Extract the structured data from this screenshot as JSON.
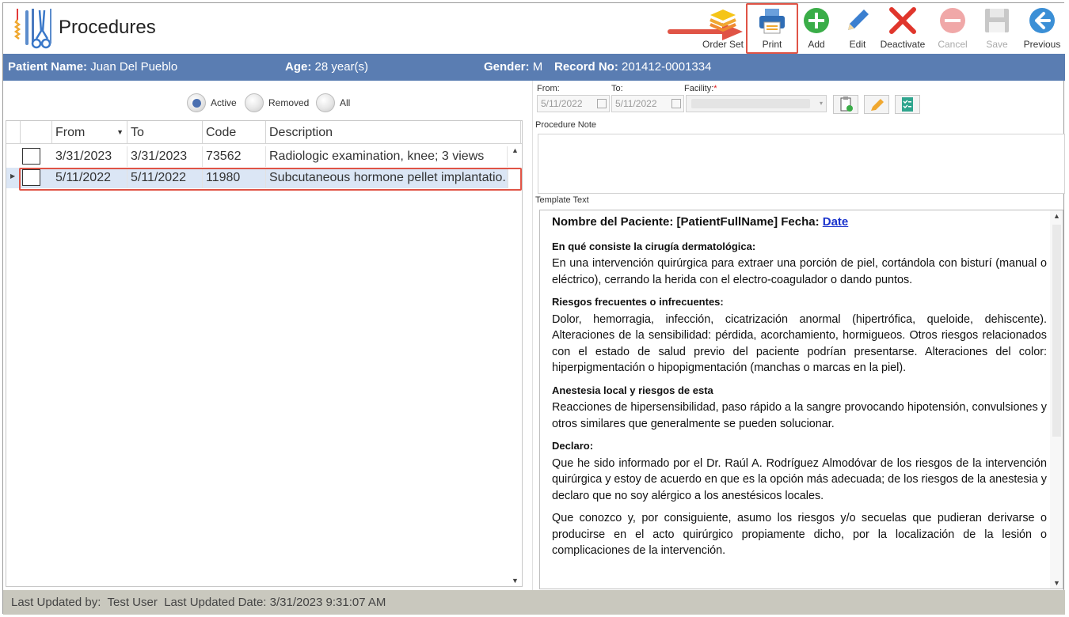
{
  "app": {
    "title": "Procedures"
  },
  "toolbar": {
    "order_set": "Order Set",
    "print": "Print",
    "add": "Add",
    "edit": "Edit",
    "deactivate": "Deactivate",
    "cancel": "Cancel",
    "save": "Save",
    "previous": "Previous"
  },
  "patient": {
    "name_label": "Patient Name:",
    "name": "Juan Del Pueblo",
    "age_label": "Age:",
    "age": "28 year(s)",
    "gender_label": "Gender:",
    "gender": "M",
    "record_label": "Record No:",
    "record": "201412-0001334"
  },
  "filters": {
    "active": "Active",
    "removed": "Removed",
    "all": "All",
    "selected": "Active"
  },
  "grid": {
    "columns": [
      "From",
      "To",
      "Code",
      "Description"
    ],
    "rows": [
      {
        "from": "3/31/2023",
        "to": "3/31/2023",
        "code": "73562",
        "description": "Radiologic examination, knee; 3 views"
      },
      {
        "from": "5/11/2022",
        "to": "5/11/2022",
        "code": "11980",
        "description": "Subcutaneous hormone pellet implantatio..."
      }
    ]
  },
  "detail": {
    "from_label": "From:",
    "from_value": "5/11/2022",
    "to_label": "To:",
    "to_value": "5/11/2022",
    "facility_label": "Facility:",
    "facility_required": "*",
    "procedure_note_label": "Procedure Note",
    "template_text_label": "Template Text"
  },
  "template": {
    "title_prefix": "Nombre del Paciente: [PatientFullName] Fecha: ",
    "title_link": "Date",
    "s1_head": "En qué consiste la cirugía dermatológica:",
    "s1_body": "En una intervención quirúrgica para extraer una porción de piel, cortándola con bisturí (manual o eléctrico), cerrando la herida con el electro-coagulador o dando puntos.",
    "s2_head": "Riesgos frecuentes o infrecuentes:",
    "s2_body": "Dolor, hemorragia, infección, cicatrización anormal (hipertrófica, queloide, dehiscente). Alteraciones de la sensibilidad: pérdida, acorchamiento, hormigueos. Otros riesgos relacionados con el estado de salud previo del paciente podrían presentarse. Alteraciones del color: hiperpigmentación o hipopigmentación (manchas o marcas en la piel).",
    "s3_head": "Anestesia local y riesgos de esta",
    "s3_body": "Reacciones de hipersensibilidad, paso rápido a la sangre provocando hipotensión, convulsiones y otros similares que generalmente se pueden solucionar.",
    "s4_head": "Declaro:",
    "s4_body": "Que he sido informado por el Dr. Raúl A. Rodríguez Almodóvar de los riesgos de la intervención quirúrgica y estoy de acuerdo en que es la opción más adecuada; de los riesgos de la anestesia y declaro que no soy alérgico a los anestésicos locales.",
    "s5_body": "Que conozco y, por consiguiente, asumo los riesgos y/o secuelas que pudieran derivarse o producirse en el acto quirúrgico propiamente dicho, por la localización de la lesión o complicaciones de la intervención."
  },
  "status": {
    "updated_by_label": "Last Updated by:",
    "updated_by": "Test User",
    "updated_date_label": "Last Updated Date:",
    "updated_date": "3/31/2023 9:31:07 AM"
  },
  "colors": {
    "header_bar": "#5a7db2",
    "highlight": "#e05446",
    "selected_row": "#dbe6f5",
    "status_bar": "#c9c8be"
  },
  "icons": [
    "procedures-logo",
    "order-set-icon",
    "printer-icon",
    "add-icon",
    "edit-icon",
    "deactivate-icon",
    "cancel-icon",
    "save-icon",
    "previous-icon",
    "calendar-icon"
  ]
}
